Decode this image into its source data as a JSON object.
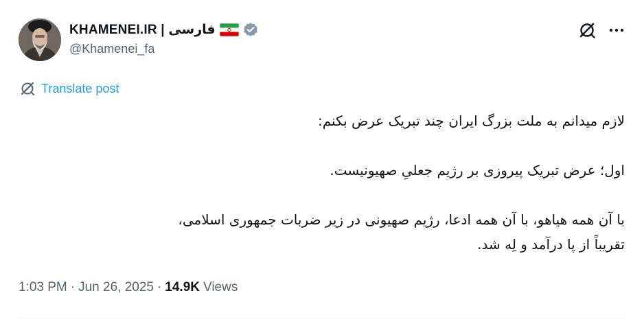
{
  "author": {
    "display_name": "KHAMENEI.IR | فارسی",
    "handle": "@Khamenei_fa",
    "verified": true,
    "verified_color": "#829aab",
    "flag": "iran-flag-icon"
  },
  "actions": {
    "grok_icon": "grok-icon",
    "more_icon": "more-icon"
  },
  "translate": {
    "label": "Translate post",
    "icon": "translate-icon",
    "color": "#1d9bf0"
  },
  "post": {
    "paragraphs": [
      "لازم میدانم به ملت بزرگ ایران چند تبریک عرض بکنم:",
      "اول؛ عرض تبریک پیروزی بر رژیم جعلیِ صهیونیست.",
      "با آن همه هیاهو، با آن همه ادعا، رژیم صهیونی در زیر ضربات جمهوری اسلامی،\nتقریباً از پا درآمد و لِه شد."
    ]
  },
  "meta": {
    "time": "1:03 PM",
    "separator": "·",
    "date": "Jun 26, 2025",
    "views_count": "14.9K",
    "views_label": "Views"
  }
}
